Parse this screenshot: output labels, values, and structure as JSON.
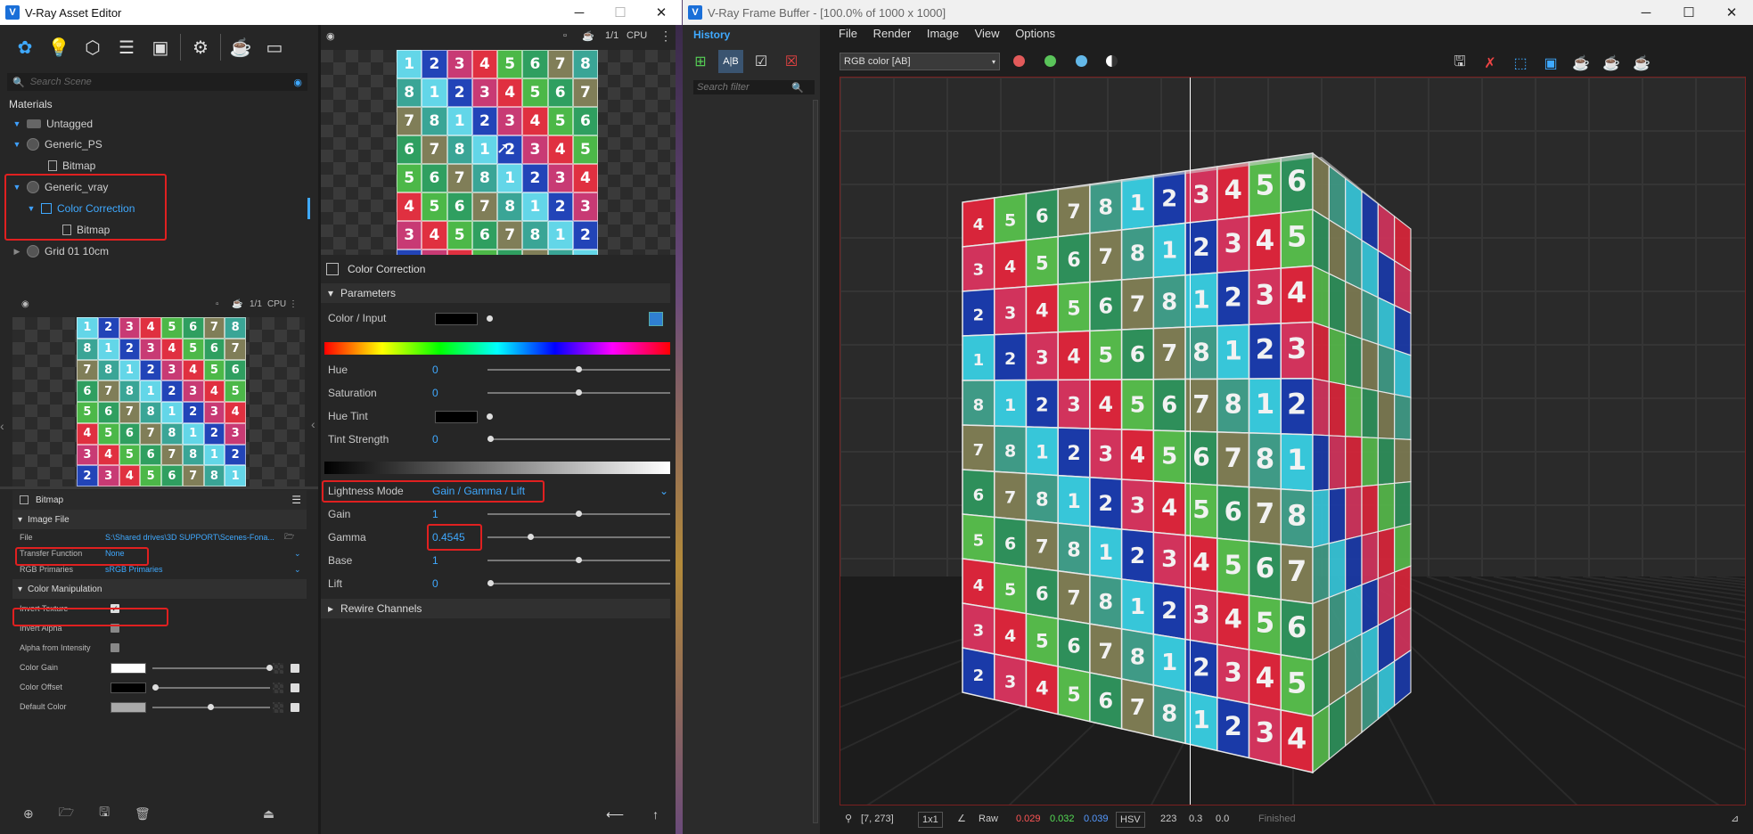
{
  "asset_editor": {
    "title": "V-Ray Asset Editor",
    "search_placeholder": "Search Scene",
    "materials_header": "Materials",
    "tree": [
      {
        "label": "Untagged"
      },
      {
        "label": "Generic_PS"
      },
      {
        "label": "Bitmap"
      },
      {
        "label": "Generic_vray"
      },
      {
        "label": "Color Correction"
      },
      {
        "label": "Bitmap"
      },
      {
        "label": "Grid 01 10cm"
      }
    ],
    "preview_cpu": "CPU",
    "preview_ratio": "1/1",
    "grid_numbers": [
      [
        1,
        2,
        3,
        4,
        5,
        6,
        7,
        8
      ],
      [
        8,
        1,
        2,
        3,
        4,
        5,
        6,
        7
      ],
      [
        7,
        8,
        1,
        2,
        3,
        4,
        5,
        6
      ],
      [
        6,
        7,
        8,
        1,
        2,
        3,
        4,
        5
      ],
      [
        5,
        6,
        7,
        8,
        1,
        2,
        3,
        4
      ],
      [
        4,
        5,
        6,
        7,
        8,
        1,
        2,
        3
      ],
      [
        3,
        4,
        5,
        6,
        7,
        8,
        1,
        2
      ],
      [
        2,
        3,
        4,
        5,
        6,
        7,
        8,
        1
      ]
    ],
    "bitmap_panel": {
      "title": "Bitmap",
      "section_image_file": "Image File",
      "file_label": "File",
      "file_value": "S:\\Shared drives\\3D SUPPORT\\Scenes-Fona...",
      "transfer_label": "Transfer Function",
      "transfer_value": "None",
      "rgb_label": "RGB Primaries",
      "rgb_value": "sRGB Primaries",
      "section_color": "Color Manipulation",
      "invert_texture": "Invert Texture",
      "invert_alpha": "Invert Alpha",
      "alpha_from_intensity": "Alpha from Intensity",
      "color_gain": "Color Gain",
      "color_offset": "Color Offset",
      "default_color": "Default Color",
      "invert_texture_checked": true,
      "invert_alpha_checked": false,
      "alpha_from_intensity_checked": false
    },
    "color_correction": {
      "title": "Color Correction",
      "section_parameters": "Parameters",
      "color_input": "Color / Input",
      "hue_label": "Hue",
      "hue_value": "0",
      "saturation_label": "Saturation",
      "saturation_value": "0",
      "hue_tint_label": "Hue Tint",
      "tint_strength_label": "Tint Strength",
      "tint_strength_value": "0",
      "lightness_mode_label": "Lightness Mode",
      "lightness_mode_value": "Gain / Gamma / Lift",
      "gain_label": "Gain",
      "gain_value": "1",
      "gamma_label": "Gamma",
      "gamma_value": "0.4545",
      "base_label": "Base",
      "base_value": "1",
      "lift_label": "Lift",
      "lift_value": "0",
      "rewire": "Rewire Channels"
    }
  },
  "frame_buffer": {
    "title": "V-Ray Frame Buffer - [100.0% of 1000 x 1000]",
    "menu": [
      "File",
      "Render",
      "Image",
      "View",
      "Options"
    ],
    "history_tab": "History",
    "search_placeholder": "Search filter",
    "channel": "RGB color [AB]",
    "thumb_labels": [
      "B",
      "A"
    ],
    "status": {
      "coords": "[7, 273]",
      "ratio": "1x1",
      "raw": "Raw",
      "r": "0.029",
      "g": "0.032",
      "b": "0.039",
      "mode": "HSV",
      "h": "223",
      "s": "0.3",
      "v": "0.0",
      "state": "Finished"
    },
    "cube_front": [
      [
        4,
        5,
        6,
        7,
        8,
        1,
        2,
        3,
        4,
        5,
        6
      ],
      [
        3,
        4,
        5,
        6,
        7,
        8,
        1,
        2,
        3,
        4,
        5
      ],
      [
        2,
        3,
        4,
        5,
        6,
        7,
        8,
        1,
        2,
        3,
        4
      ],
      [
        1,
        2,
        3,
        4,
        5,
        6,
        7,
        8,
        1,
        2,
        3
      ],
      [
        8,
        1,
        2,
        3,
        4,
        5,
        6,
        7,
        8,
        1,
        2
      ],
      [
        7,
        8,
        1,
        2,
        3,
        4,
        5,
        6,
        7,
        8,
        1
      ],
      [
        6,
        7,
        8,
        1,
        2,
        3,
        4,
        5,
        6,
        7,
        8
      ],
      [
        5,
        6,
        7,
        8,
        1,
        2,
        3,
        4,
        5,
        6,
        7
      ],
      [
        4,
        5,
        6,
        7,
        8,
        1,
        2,
        3,
        4,
        5,
        6
      ],
      [
        3,
        4,
        5,
        6,
        7,
        8,
        1,
        2,
        3,
        4,
        5
      ],
      [
        2,
        3,
        4,
        5,
        6,
        7,
        8,
        1,
        2,
        3,
        4
      ]
    ]
  },
  "colors": {
    "accent": "#3fa9ff",
    "highlight": "#e02020"
  }
}
